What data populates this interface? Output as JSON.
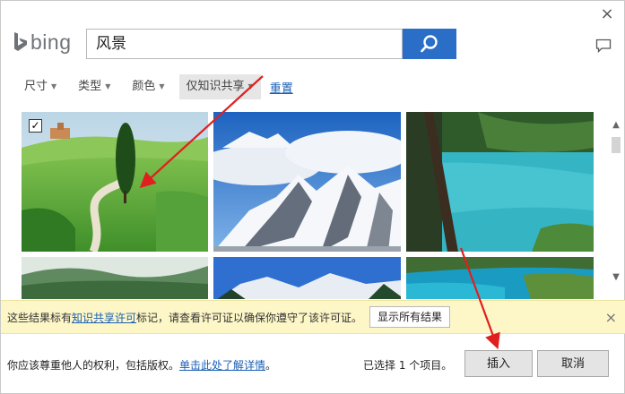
{
  "header": {
    "logo_text": "bing",
    "close_label": "×"
  },
  "search": {
    "value": "风景"
  },
  "filters": [
    {
      "label": "尺寸"
    },
    {
      "label": "类型"
    },
    {
      "label": "颜色"
    },
    {
      "label": "仅知识共享",
      "active": true
    }
  ],
  "reset_label": "重置",
  "grid": {
    "first_tile_checked": true,
    "check_mark": "✓"
  },
  "notice": {
    "text_before": "这些结果标有",
    "link": "知识共享许可",
    "text_after": "标记，请查看许可证以确保你遵守了该许可证。",
    "show_all_button": "显示所有结果",
    "close_label": "×"
  },
  "footer": {
    "rights_text": "你应该尊重他人的权利，包括版权。",
    "rights_link": "单击此处了解详情",
    "rights_suffix": "。",
    "selected_status": "已选择 1 个项目。",
    "insert_button": "插入",
    "cancel_button": "取消"
  },
  "colors": {
    "accent": "#2a6ec7",
    "annotation_arrow": "#e0201e",
    "notice_bg": "#fdf6c7"
  }
}
